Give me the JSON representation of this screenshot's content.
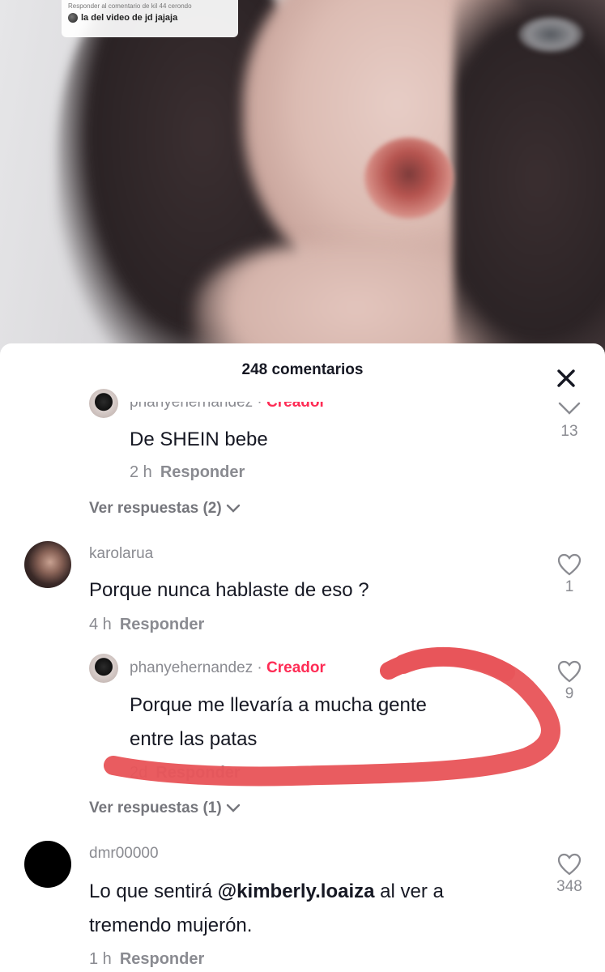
{
  "video": {
    "reply_bubble_caption": "Responder al comentario de kil 44 cerondo",
    "reply_bubble_text": "la del video de jd jajaja"
  },
  "sheet": {
    "title": "248 comentarios",
    "close_icon": "close-icon"
  },
  "comments": [
    {
      "username": "phanyehernandez",
      "badge": "Creador",
      "text": "De SHEIN bebe",
      "time": "2 h",
      "reply_label": "Responder",
      "likes": "13",
      "view_replies": "Ver respuestas (2)"
    },
    {
      "username": "karolarua",
      "text": "Porque nunca hablaste de eso ?",
      "time": "4 h",
      "reply_label": "Responder",
      "likes": "1"
    },
    {
      "username": "phanyehernandez",
      "badge": "Creador",
      "text_line1": "Porque me llevaría a mucha gente",
      "text_line2": "entre las patas",
      "time": "2d",
      "reply_label": "Responder",
      "likes": "9",
      "view_replies": "Ver respuestas (1)"
    },
    {
      "username": "dmr00000",
      "text_prefix": "Lo que sentirá ",
      "mention": "@kimberly.loaiza",
      "text_suffix": " al ver a",
      "text_line2": "tremendo mujerón.",
      "time": "1 h",
      "reply_label": "Responder",
      "likes": "348"
    }
  ],
  "colors": {
    "creator_badge": "#fe2c55",
    "scribble": "#e8555a",
    "secondary_text": "#8a8b91"
  }
}
